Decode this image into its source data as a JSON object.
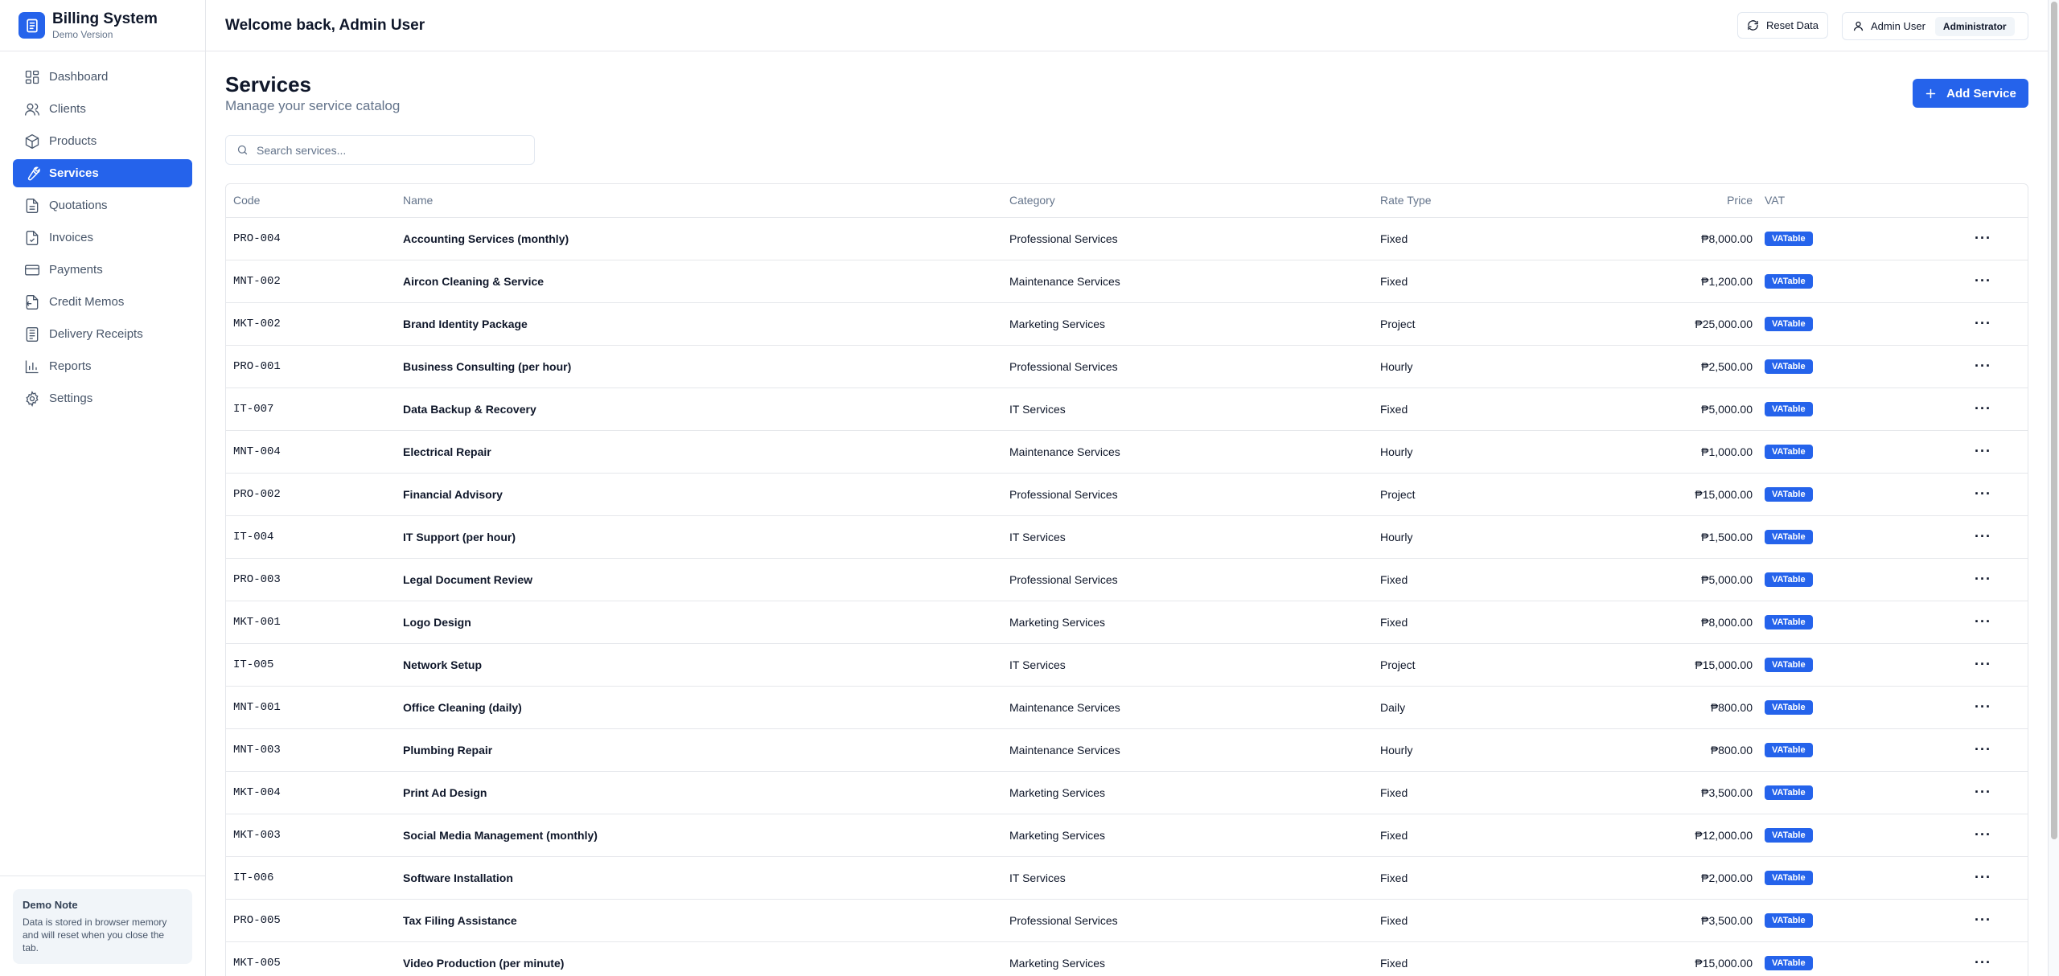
{
  "app": {
    "title": "Billing System",
    "subtitle": "Demo Version"
  },
  "sidebar": {
    "items": [
      {
        "label": "Dashboard",
        "icon": "dashboard-icon"
      },
      {
        "label": "Clients",
        "icon": "users-icon"
      },
      {
        "label": "Products",
        "icon": "package-icon"
      },
      {
        "label": "Services",
        "icon": "wrench-icon",
        "active": true
      },
      {
        "label": "Quotations",
        "icon": "document-icon"
      },
      {
        "label": "Invoices",
        "icon": "file-check-icon"
      },
      {
        "label": "Payments",
        "icon": "credit-card-icon"
      },
      {
        "label": "Credit Memos",
        "icon": "file-minus-icon"
      },
      {
        "label": "Delivery Receipts",
        "icon": "receipt-icon"
      },
      {
        "label": "Reports",
        "icon": "bar-chart-icon"
      },
      {
        "label": "Settings",
        "icon": "gear-icon"
      }
    ],
    "demo_note": {
      "title": "Demo Note",
      "text": "Data is stored in browser memory and will reset when you close the tab."
    }
  },
  "header": {
    "welcome": "Welcome back, Admin User",
    "reset_label": "Reset Data",
    "user_name": "Admin User",
    "role": "Administrator"
  },
  "page": {
    "title": "Services",
    "subtitle": "Manage your service catalog",
    "add_label": "Add Service",
    "search_placeholder": "Search services..."
  },
  "table": {
    "columns": {
      "code": "Code",
      "name": "Name",
      "category": "Category",
      "rate_type": "Rate Type",
      "price": "Price",
      "vat": "VAT"
    },
    "rows": [
      {
        "code": "PRO-004",
        "name": "Accounting Services (monthly)",
        "category": "Professional Services",
        "rate_type": "Fixed",
        "price": "₱8,000.00",
        "vat": "VATable"
      },
      {
        "code": "MNT-002",
        "name": "Aircon Cleaning & Service",
        "category": "Maintenance Services",
        "rate_type": "Fixed",
        "price": "₱1,200.00",
        "vat": "VATable"
      },
      {
        "code": "MKT-002",
        "name": "Brand Identity Package",
        "category": "Marketing Services",
        "rate_type": "Project",
        "price": "₱25,000.00",
        "vat": "VATable"
      },
      {
        "code": "PRO-001",
        "name": "Business Consulting (per hour)",
        "category": "Professional Services",
        "rate_type": "Hourly",
        "price": "₱2,500.00",
        "vat": "VATable"
      },
      {
        "code": "IT-007",
        "name": "Data Backup & Recovery",
        "category": "IT Services",
        "rate_type": "Fixed",
        "price": "₱5,000.00",
        "vat": "VATable"
      },
      {
        "code": "MNT-004",
        "name": "Electrical Repair",
        "category": "Maintenance Services",
        "rate_type": "Hourly",
        "price": "₱1,000.00",
        "vat": "VATable"
      },
      {
        "code": "PRO-002",
        "name": "Financial Advisory",
        "category": "Professional Services",
        "rate_type": "Project",
        "price": "₱15,000.00",
        "vat": "VATable"
      },
      {
        "code": "IT-004",
        "name": "IT Support (per hour)",
        "category": "IT Services",
        "rate_type": "Hourly",
        "price": "₱1,500.00",
        "vat": "VATable"
      },
      {
        "code": "PRO-003",
        "name": "Legal Document Review",
        "category": "Professional Services",
        "rate_type": "Fixed",
        "price": "₱5,000.00",
        "vat": "VATable"
      },
      {
        "code": "MKT-001",
        "name": "Logo Design",
        "category": "Marketing Services",
        "rate_type": "Fixed",
        "price": "₱8,000.00",
        "vat": "VATable"
      },
      {
        "code": "IT-005",
        "name": "Network Setup",
        "category": "IT Services",
        "rate_type": "Project",
        "price": "₱15,000.00",
        "vat": "VATable"
      },
      {
        "code": "MNT-001",
        "name": "Office Cleaning (daily)",
        "category": "Maintenance Services",
        "rate_type": "Daily",
        "price": "₱800.00",
        "vat": "VATable"
      },
      {
        "code": "MNT-003",
        "name": "Plumbing Repair",
        "category": "Maintenance Services",
        "rate_type": "Hourly",
        "price": "₱800.00",
        "vat": "VATable"
      },
      {
        "code": "MKT-004",
        "name": "Print Ad Design",
        "category": "Marketing Services",
        "rate_type": "Fixed",
        "price": "₱3,500.00",
        "vat": "VATable"
      },
      {
        "code": "MKT-003",
        "name": "Social Media Management (monthly)",
        "category": "Marketing Services",
        "rate_type": "Fixed",
        "price": "₱12,000.00",
        "vat": "VATable"
      },
      {
        "code": "IT-006",
        "name": "Software Installation",
        "category": "IT Services",
        "rate_type": "Fixed",
        "price": "₱2,000.00",
        "vat": "VATable"
      },
      {
        "code": "PRO-005",
        "name": "Tax Filing Assistance",
        "category": "Professional Services",
        "rate_type": "Fixed",
        "price": "₱3,500.00",
        "vat": "VATable"
      },
      {
        "code": "MKT-005",
        "name": "Video Production (per minute)",
        "category": "Marketing Services",
        "rate_type": "Fixed",
        "price": "₱15,000.00",
        "vat": "VATable"
      }
    ]
  },
  "colors": {
    "accent": "#2563eb",
    "muted": "#64748b",
    "border": "#e5e7eb"
  }
}
